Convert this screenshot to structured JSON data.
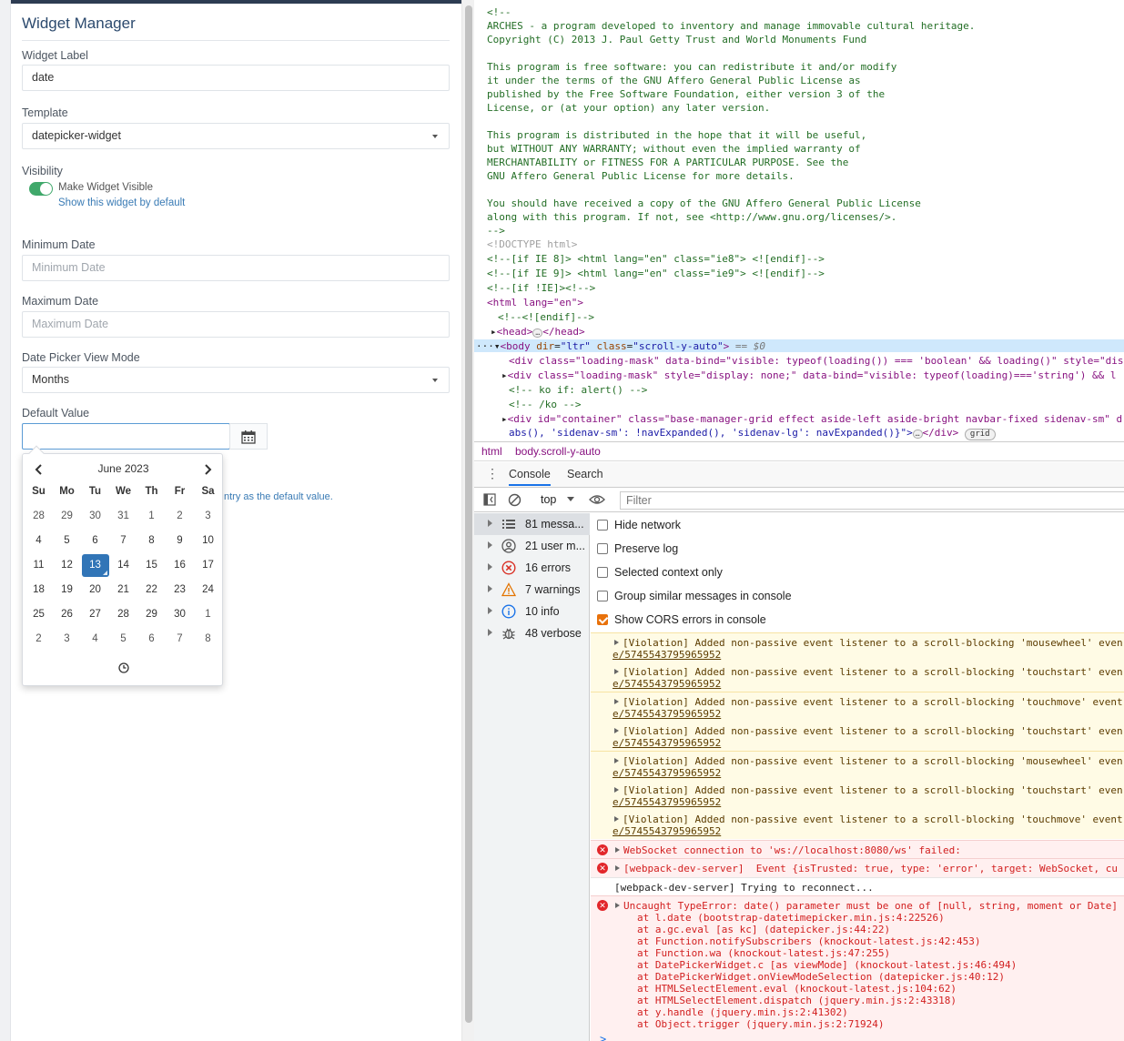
{
  "widget_manager": {
    "title": "Widget Manager",
    "widget_label": {
      "label": "Widget Label",
      "value": "date"
    },
    "template": {
      "label": "Template",
      "value": "datepicker-widget"
    },
    "visibility": {
      "label": "Visibility",
      "toggle_label": "Make Widget Visible",
      "help": "Show this widget by default",
      "on": true
    },
    "minimum_date": {
      "label": "Minimum Date",
      "placeholder": "Minimum Date"
    },
    "maximum_date": {
      "label": "Maximum Date",
      "placeholder": "Maximum Date"
    },
    "view_mode": {
      "label": "Date Picker View Mode",
      "value": "Months"
    },
    "default_value": {
      "label": "Default Value",
      "value": "",
      "help_fragment": "ntry as the default value."
    }
  },
  "datepicker": {
    "month": "June 2023",
    "prev": "‹",
    "next": "›",
    "dow": [
      "Su",
      "Mo",
      "Tu",
      "We",
      "Th",
      "Fr",
      "Sa"
    ],
    "weeks": [
      [
        "28",
        "29",
        "30",
        "31",
        "1",
        "2",
        "3"
      ],
      [
        "4",
        "5",
        "6",
        "7",
        "8",
        "9",
        "10"
      ],
      [
        "11",
        "12",
        "13",
        "14",
        "15",
        "16",
        "17"
      ],
      [
        "18",
        "19",
        "20",
        "21",
        "22",
        "23",
        "24"
      ],
      [
        "25",
        "26",
        "27",
        "28",
        "29",
        "30",
        "1"
      ],
      [
        "2",
        "3",
        "4",
        "5",
        "6",
        "7",
        "8"
      ]
    ],
    "selected": "13"
  },
  "devtools": {
    "source_lines": [
      {
        "cls": "cm",
        "text": "<!--"
      },
      {
        "cls": "cm",
        "text": "ARCHES - a program developed to inventory and manage immovable cultural heritage."
      },
      {
        "cls": "cm",
        "text": "Copyright (C) 2013 J. Paul Getty Trust and World Monuments Fund"
      },
      {
        "cls": "cm",
        "text": ""
      },
      {
        "cls": "cm",
        "text": "This program is free software: you can redistribute it and/or modify"
      },
      {
        "cls": "cm",
        "text": "it under the terms of the GNU Affero General Public License as"
      },
      {
        "cls": "cm",
        "text": "published by the Free Software Foundation, either version 3 of the"
      },
      {
        "cls": "cm",
        "text": "License, or (at your option) any later version."
      },
      {
        "cls": "cm",
        "text": ""
      },
      {
        "cls": "cm",
        "text": "This program is distributed in the hope that it will be useful,"
      },
      {
        "cls": "cm",
        "text": "but WITHOUT ANY WARRANTY; without even the implied warranty of"
      },
      {
        "cls": "cm",
        "text": "MERCHANTABILITY or FITNESS FOR A PARTICULAR PURPOSE. See the"
      },
      {
        "cls": "cm",
        "text": "GNU Affero General Public License for more details."
      },
      {
        "cls": "cm",
        "text": ""
      },
      {
        "cls": "cm",
        "text": "You should have received a copy of the GNU Affero General Public License"
      },
      {
        "cls": "cm",
        "text": "along with this program. If not, see <http://www.gnu.org/licenses/>."
      },
      {
        "cls": "cm",
        "text": "-->"
      }
    ],
    "doctype": "<!DOCTYPE html>",
    "ie8": "<!--[if IE 8]> <html lang=\"en\" class=\"ie8\"> <![endif]-->",
    "ie9": "<!--[if IE 9]> <html lang=\"en\" class=\"ie9\"> <![endif]-->",
    "notie": "<!--[if !IE]><!-->",
    "html_open": "<html lang=\"en\">",
    "endif": "<!--<![endif]-->",
    "head": "head",
    "body_line": {
      "tag": "body",
      "a1": "dir",
      "v1": "\"ltr\"",
      "a2": "class",
      "v2": "\"scroll-y-auto\"",
      "eq": "== $0"
    },
    "div1": "<div class=\"loading-mask\" data-bind=\"visible: typeof(loading()) === 'boolean' && loading()\" style=\"dis",
    "div2": "<div class=\"loading-mask\" style=\"display: none;\" data-bind=\"visible: typeof(loading)==='string') && l",
    "ko_if": "<!-- ko if: alert() -->",
    "ko_end": "<!-- /ko -->",
    "container1": "<div id=\"container\" class=\"base-manager-grid effect aside-left aside-bright navbar-fixed sidenav-sm\" d",
    "container2": "abs(), 'sidenav-sm': !navExpanded(), 'sidenav-lg': navExpanded()}\">",
    "container_close": "</div>",
    "grid_badge": "grid",
    "crumbs": [
      "html",
      "body.scroll-y-auto"
    ],
    "tabs": [
      "Console",
      "Search"
    ],
    "context": "top",
    "filter_placeholder": "Filter",
    "sidebar": [
      {
        "label": "81 messa...",
        "icon": "list-icon"
      },
      {
        "label": "21 user m...",
        "icon": "user-icon"
      },
      {
        "label": "16 errors",
        "icon": "error-icon"
      },
      {
        "label": "7 warnings",
        "icon": "warning-icon"
      },
      {
        "label": "10 info",
        "icon": "info-icon"
      },
      {
        "label": "48 verbose",
        "icon": "bug-icon"
      }
    ],
    "settings": [
      {
        "label": "Hide network",
        "checked": false
      },
      {
        "label": "Preserve log",
        "checked": false
      },
      {
        "label": "Selected context only",
        "checked": false
      },
      {
        "label": "Group similar messages in console",
        "checked": false
      },
      {
        "label": "Show CORS errors in console",
        "checked": true
      }
    ],
    "violations": [
      {
        "text": "[Violation] Added non-passive event listener to a scroll-blocking 'mousewheel' even",
        "url": "e/5745543795965952"
      },
      {
        "text": "[Violation] Added non-passive event listener to a scroll-blocking 'touchstart' even",
        "url": "e/5745543795965952"
      },
      {
        "text": "[Violation] Added non-passive event listener to a scroll-blocking 'touchmove' event",
        "url": "e/5745543795965952"
      },
      {
        "text": "[Violation] Added non-passive event listener to a scroll-blocking 'touchstart' even",
        "url": "e/5745543795965952"
      },
      {
        "text": "[Violation] Added non-passive event listener to a scroll-blocking 'mousewheel' even",
        "url": "e/5745543795965952"
      },
      {
        "text": "[Violation] Added non-passive event listener to a scroll-blocking 'touchstart' even",
        "url": "e/5745543795965952"
      },
      {
        "text": "[Violation] Added non-passive event listener to a scroll-blocking 'touchmove' event",
        "url": "e/5745543795965952"
      }
    ],
    "ws_error": "WebSocket connection to 'ws://localhost:8080/ws' failed:",
    "wds_error": "[webpack-dev-server]  Event {isTrusted: true, type: 'error', target: WebSocket, cu",
    "wds_info": "[webpack-dev-server] Trying to reconnect...",
    "type_error": "Uncaught TypeError: date() parameter must be one of [null, string, moment or Date]",
    "stack": [
      "at l.date (bootstrap-datetimepicker.min.js:4:22526)",
      "at a.gc.eval [as kc] (datepicker.js:44:22)",
      "at Function.notifySubscribers (knockout-latest.js:42:453)",
      "at Function.wa (knockout-latest.js:47:255)",
      "at DatePickerWidget.c [as viewMode] (knockout-latest.js:46:494)",
      "at DatePickerWidget.onViewModeSelection (datepicker.js:40:12)",
      "at HTMLSelectElement.eval (knockout-latest.js:104:62)",
      "at HTMLSelectElement.dispatch (jquery.min.js:2:43318)",
      "at y.handle (jquery.min.js:2:41302)",
      "at Object.trigger (jquery.min.js:2:71924)"
    ],
    "prompt": ">"
  }
}
